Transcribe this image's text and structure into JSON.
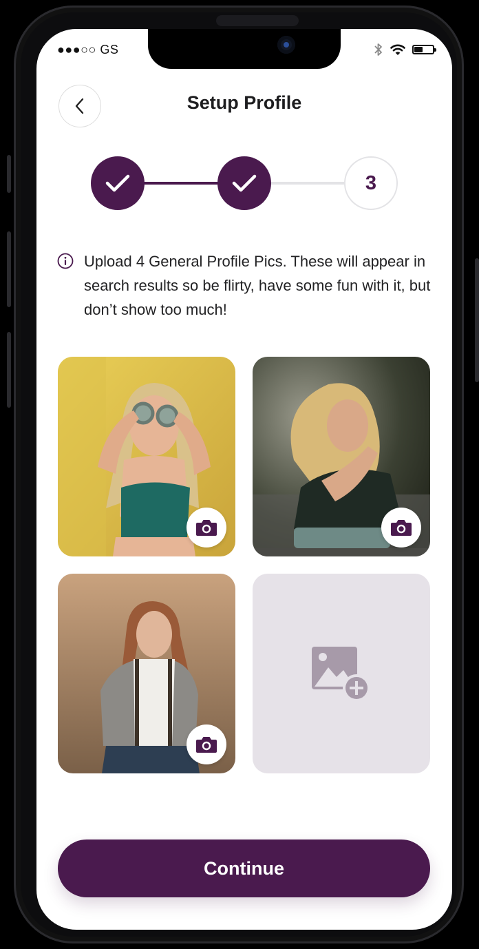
{
  "status_bar": {
    "carrier": "●●●○○ GS"
  },
  "header": {
    "title": "Setup Profile"
  },
  "stepper": {
    "steps": [
      {
        "state": "done"
      },
      {
        "state": "done"
      },
      {
        "state": "current",
        "label": "3"
      }
    ]
  },
  "info": {
    "text": "Upload 4 General Profile Pics. These will appear in search results so be flirty, have some fun with it, but don’t show too much!"
  },
  "photos": [
    {
      "state": "filled",
      "icon": "camera-icon"
    },
    {
      "state": "filled",
      "icon": "camera-icon"
    },
    {
      "state": "filled",
      "icon": "camera-icon"
    },
    {
      "state": "empty",
      "icon": "image-add-icon"
    }
  ],
  "footer": {
    "continue_label": "Continue"
  },
  "colors": {
    "primary": "#4a1a4e",
    "empty_tile": "#e6e2e8",
    "step_inactive": "#e3e3e6"
  }
}
